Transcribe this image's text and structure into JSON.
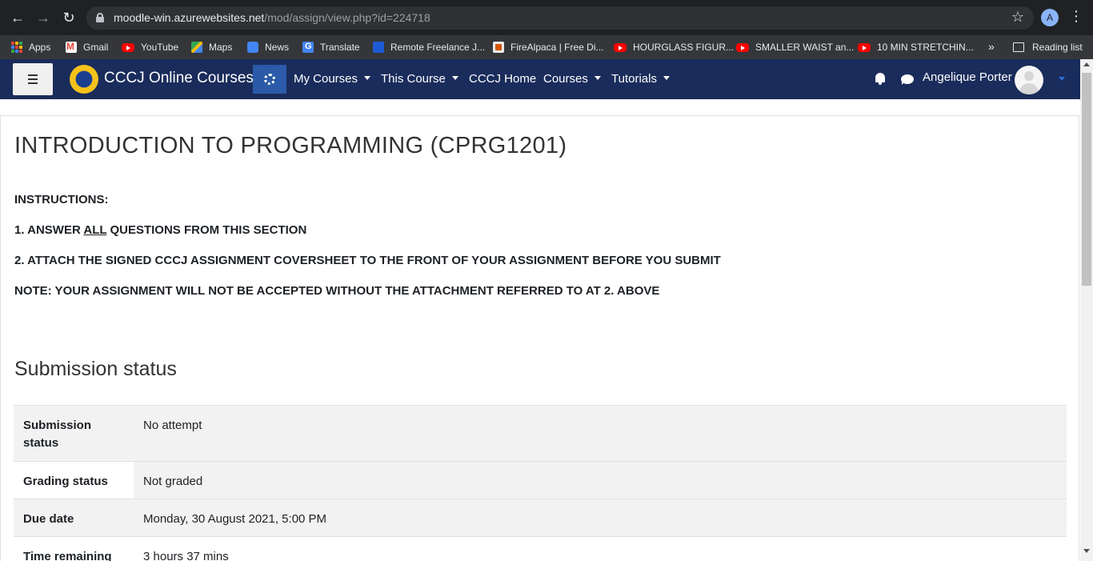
{
  "browser": {
    "url_host": "moodle-win.azurewebsites.net",
    "url_path": "/mod/assign/view.php?id=224718",
    "profile_initial": "A",
    "bookmarks": [
      {
        "label": "Apps",
        "icon": "apps-grid-icon"
      },
      {
        "label": "Gmail",
        "icon": "gmail-icon"
      },
      {
        "label": "YouTube",
        "icon": "youtube-icon"
      },
      {
        "label": "Maps",
        "icon": "maps-icon"
      },
      {
        "label": "News",
        "icon": "news-icon"
      },
      {
        "label": "Translate",
        "icon": "translate-icon"
      },
      {
        "label": "Remote Freelance J...",
        "icon": "remote-icon"
      },
      {
        "label": "FireAlpaca | Free Di...",
        "icon": "firealpaca-icon"
      },
      {
        "label": "HOURGLASS FIGUR...",
        "icon": "youtube-icon"
      },
      {
        "label": "SMALLER WAIST an...",
        "icon": "youtube-icon"
      },
      {
        "label": "10 MIN STRETCHIN...",
        "icon": "youtube-icon"
      }
    ],
    "more_bookmarks": "»",
    "reading_list": "Reading list"
  },
  "navbar": {
    "site_name": "CCCJ Online Courses",
    "items": [
      {
        "label": "My Courses",
        "has_caret": true
      },
      {
        "label": "This Course",
        "has_caret": true
      },
      {
        "label": "CCCJ Home",
        "has_caret": false
      },
      {
        "label": "Courses",
        "has_caret": true
      },
      {
        "label": "Tutorials",
        "has_caret": true
      }
    ],
    "user_name": "Angelique Porter"
  },
  "page": {
    "course_title": "INTRODUCTION TO PROGRAMMING (CPRG1201)",
    "instructions_heading": "INSTRUCTIONS:",
    "instruction_1_pre": "1. ANSWER ",
    "instruction_1_underlined": "ALL",
    "instruction_1_post": " QUESTIONS FROM THIS SECTION",
    "instruction_2": "2. ATTACH THE SIGNED CCCJ ASSIGNMENT COVERSHEET TO THE FRONT OF YOUR ASSIGNMENT BEFORE YOU SUBMIT",
    "note": "NOTE: YOUR ASSIGNMENT WILL NOT BE ACCEPTED WITHOUT THE ATTACHMENT REFERRED TO AT 2. ABOVE",
    "section_heading": "Submission status"
  },
  "submission_table": [
    {
      "label": "Submission status",
      "value": "No attempt"
    },
    {
      "label": "Grading status",
      "value": "Not graded"
    },
    {
      "label": "Due date",
      "value": "Monday, 30 August 2021, 5:00 PM"
    },
    {
      "label": "Time remaining",
      "value": "3 hours 37 mins"
    }
  ]
}
